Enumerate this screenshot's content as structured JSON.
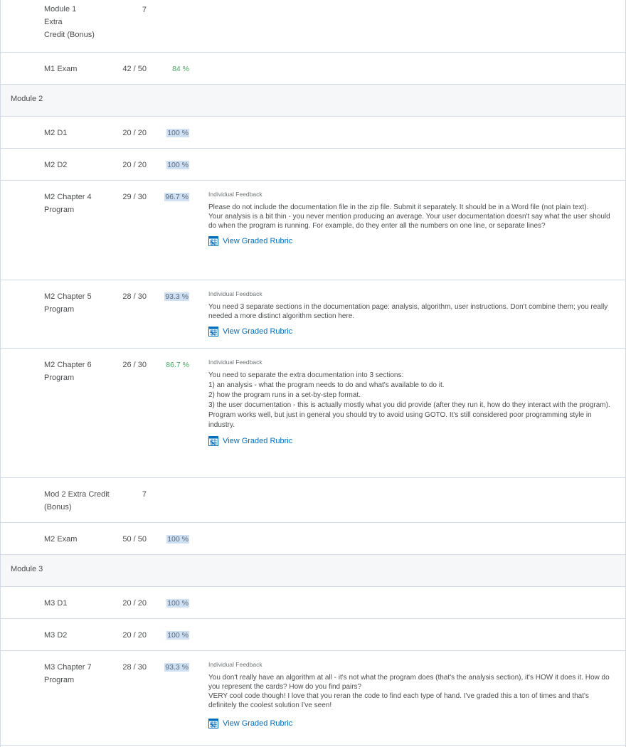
{
  "colors": {
    "accent_link": "#006fbf",
    "percent_green": "#46a661",
    "highlight": "#cfe0f3",
    "divider": "#d3d9e3"
  },
  "rows": {
    "r1": {
      "name": "Module 1\nExtra\nCredit (Bonus)",
      "score": "7",
      "percent": ""
    },
    "r2": {
      "name": "M1 Exam",
      "score": "42 / 50",
      "percent": "84 %"
    },
    "m2": {
      "title": "Module 2"
    },
    "r3": {
      "name": "M2 D1",
      "score": "20 / 20",
      "percent": "100 %"
    },
    "r4": {
      "name": "M2 D2",
      "score": "20 / 20",
      "percent": "100 %"
    },
    "r5": {
      "name": "M2 Chapter 4 Program",
      "score": "29 / 30",
      "percent": "96.7 %",
      "feedback_title": "Individual Feedback",
      "feedback": "Please do not include the documentation file in the zip file.  Submit it separately.  It should be in a Word file (not plain text).\nYour analysis is a bit thin - you never mention producing an average.  Your user documentation doesn't say what the user should do when the program is running.  For example, do they enter all the numbers on one line, or separate lines?",
      "rubric_label": "View Graded Rubric"
    },
    "r6": {
      "name": "M2 Chapter 5 Program",
      "score": "28 / 30",
      "percent": "93.3 %",
      "feedback_title": "Individual Feedback",
      "feedback": "You need 3 separate sections in the documentation page: analysis, algorithm, user instructions.  Don't combine them; you really needed a more distinct algorithm section here.",
      "rubric_label": "View Graded Rubric"
    },
    "r7": {
      "name": "M2 Chapter 6 Program",
      "score": "26 / 30",
      "percent": "86.7 %",
      "feedback_title": "Individual Feedback",
      "feedback": "You need to separate the extra documentation into 3 sections:\n1) an analysis - what the program needs to do and what's available to do it.\n2) how the program runs in a set-by-step format.\n3) the user documentation - this is actually mostly what you did provide (after they run it, how do they interact with the program).\nProgram works well, but just in general you should try to avoid using GOTO.  It's still considered poor programming style in industry.",
      "rubric_label": "View Graded Rubric"
    },
    "r8": {
      "name": "Mod 2 Extra Credit (Bonus)",
      "score": "7",
      "percent": ""
    },
    "r9": {
      "name": "M2 Exam",
      "score": "50 / 50",
      "percent": "100 %"
    },
    "m3": {
      "title": "Module 3"
    },
    "r10": {
      "name": "M3 D1",
      "score": "20 / 20",
      "percent": "100 %"
    },
    "r11": {
      "name": "M3 D2",
      "score": "20 / 20",
      "percent": "100 %"
    },
    "r12": {
      "name": "M3 Chapter 7 Program",
      "score": "28 / 30",
      "percent": "93.3 %",
      "feedback_title": "Individual Feedback",
      "feedback": "You don't really have an algorithm at all - it's not what the program does (that's the analysis section), it's HOW it does it.  How do you represent the cards?  How do you find pairs?\nVERY cool code though!  I love that you reran the code to find each type of hand.  I've graded this a ton of times and that's definitely the coolest solution I've seen!",
      "rubric_label": "View Graded Rubric"
    }
  }
}
